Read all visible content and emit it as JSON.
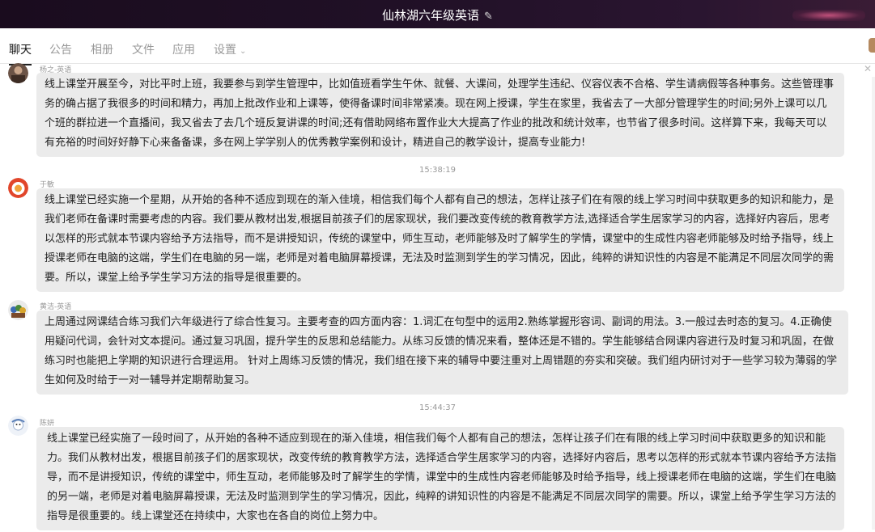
{
  "window": {
    "title": "仙林湖六年级英语",
    "edit_icon": "pencil-icon"
  },
  "tabs": [
    {
      "label": "聊天",
      "active": true
    },
    {
      "label": "公告",
      "active": false
    },
    {
      "label": "相册",
      "active": false
    },
    {
      "label": "文件",
      "active": false
    },
    {
      "label": "应用",
      "active": false
    },
    {
      "label": "设置",
      "active": false,
      "dropdown": true
    }
  ],
  "messages": [
    {
      "sender": "杨之-英语",
      "text": "线上课堂开展至今，对比平时上班，我要参与到学生管理中，比如值班看学生午休、就餐、大课间，处理学生违纪、仪容仪表不合格、学生请病假等各种事务。这些管理事务的确占据了我很多的时间和精力，再加上批改作业和上课等，使得备课时间非常紧凑。现在网上授课，学生在家里，我省去了一大部分管理学生的时间;另外上课可以几个班的群拉进一个直播间，我又省去了去几个班反复讲课的时间;还有借助网络布置作业大大提高了作业的批改和统计效率，也节省了很多时间。这样算下来，我每天可以有充裕的时间好好静下心来备备课，多在网上学学别人的优秀教学案例和设计，精进自己的教学设计，提高专业能力!"
    },
    {
      "time": "15:38:19"
    },
    {
      "sender": "于敏",
      "text": "线上课堂已经实施一个星期，从开始的各种不适应到现在的渐入佳境，相信我们每个人都有自己的想法，怎样让孩子们在有限的线上学习时间中获取更多的知识和能力，是我们老师在备课时需要考虑的内容。我们要从教材出发,根据目前孩子们的居家现状，我们要改变传统的教育教学方法,选择适合学生居家学习的内容，选择好内容后，思考以怎样的形式就本节课内容给予方法指导，而不是讲授知识，传统的课堂中，师生互动，老师能够及时了解学生的学情，课堂中的生成性内容老师能够及时给予指导，线上授课老师在电脑的这端，学生们在电脑的另一端，老师是对着电脑屏幕授课，无法及时监测到学生的学习情况，因此，纯粹的讲知识性的内容是不能满足不同层次同学的需要。所以，课堂上给予学生学习方法的指导是很重要的。"
    },
    {
      "sender": "黄洁-英语",
      "text": "上周通过网课结合练习我们六年级进行了综合性复习。主要考查的四方面内容：1.词汇在句型中的运用2.熟练掌握形容词、副词的用法。3.一般过去时态的复习。4.正确使用疑问代词，会针对文本提问。通过复习巩固，提升学生的反思和总结能力。从练习反馈的情况来看，整体还是不错的。学生能够结合网课内容进行及时复习和巩固，在做练习时也能把上学期的知识进行合理运用。 针对上周练习反馈的情况，我们组在接下来的辅导中要注重对上周错题的夯实和突破。我们组内研讨对于一些学习较为薄弱的学生如何及时给于一对一辅导并定期帮助复习。"
    },
    {
      "time": "15:44:37"
    },
    {
      "sender": "陈妍",
      "text": "线上课堂已经实施了一段时间了，从开始的各种不适应到现在的渐入佳境，相信我们每个人都有自己的想法，怎样让孩子们在有限的线上学习时间中获取更多的知识和能力。我们从教材出发，根据目前孩子们的居家现状，改变传统的教育教学方法，选择适合学生居家学习的内容，选择好内容后，思考以怎样的形式就本节课内容给予方法指导，而不是讲授知识，传统的课堂中，师生互动，老师能够及时了解学生的学情，课堂中的生成性内容老师能够及时给予指导，线上授课老师在电脑的这端，学生们在电脑的另一端，老师是对着电脑屏幕授课，无法及时监测到学生的学习情况，因此，纯粹的讲知识性的内容是不能满足不同层次同学的需要。所以，课堂上给予学生学习方法的指导是很重要的。线上课堂还在持续中，大家也在各自的岗位上努力中。"
    }
  ]
}
